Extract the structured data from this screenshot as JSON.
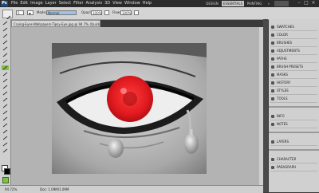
{
  "app": {
    "logo": "Ps",
    "menu": [
      "File",
      "Edit",
      "Image",
      "Layer",
      "Select",
      "Filter",
      "Analysis",
      "3D",
      "View",
      "Window",
      "Help"
    ],
    "workspaces": [
      "DESIGN",
      "ESSENTIALS",
      "PAINTING"
    ],
    "window_controls": [
      "–",
      "□",
      "×"
    ]
  },
  "options": {
    "mode_label": "Mode:",
    "mode_value": "Normal",
    "opacity_label": "Opacity:",
    "opacity_value": "100%",
    "flow_label": "Flow:",
    "flow_value": "100%"
  },
  "document": {
    "tab_title": "Crying-Eyes-Wallpapers-Tipsy-Eye.jpg @ 94.7% (Quick Mask/8)",
    "status_zoom": "94.72%",
    "status_doc": "Doc: 1.09M/1.09M"
  },
  "colors": {
    "foreground": "#ffffff",
    "background": "#000000",
    "quickmask": "#e0161a",
    "accent_green": "#7ec242"
  },
  "panels": {
    "group1": [
      "SWATCHES",
      "COLOR",
      "BRUSHES",
      "ADJUSTMENTS",
      "PATHS",
      "BRUSH PRESETS",
      "MASKS",
      "HISTORY",
      "STYLES",
      "TOOLS"
    ],
    "group2": [
      "INFO",
      "NOTES"
    ],
    "group3": [
      "LAYERS"
    ],
    "group4": [
      "CHARACTER",
      "PARAGRAPH"
    ]
  }
}
